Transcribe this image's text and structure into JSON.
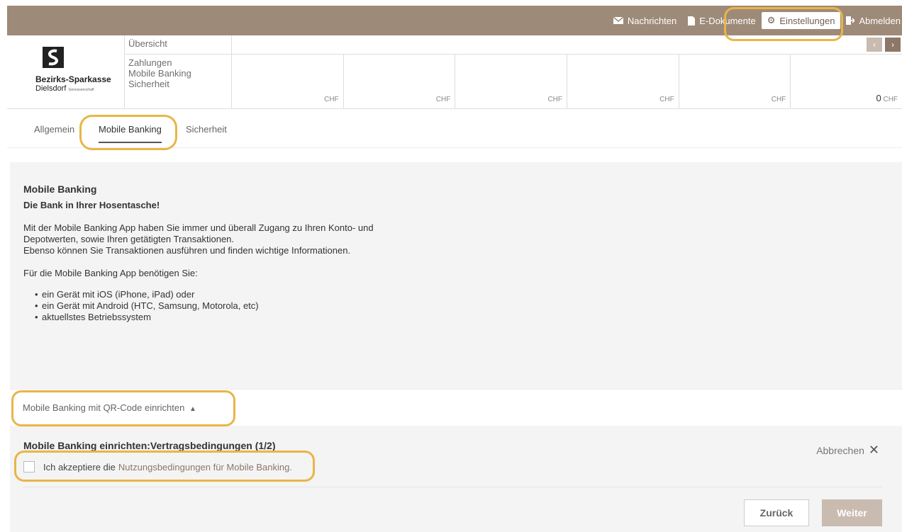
{
  "topnav": {
    "messages": "Nachrichten",
    "edocs": "E-Dokumente",
    "settings": "Einstellungen",
    "logout": "Abmelden"
  },
  "logo": {
    "line1": "Bezirks-Sparkasse",
    "line2": "Dielsdorf",
    "line2_small": "Genossenschaft"
  },
  "menu": {
    "overview": "Übersicht",
    "payments": "Zahlungen",
    "mobile": "Mobile Banking",
    "security": "Sicherheit"
  },
  "accounts": [
    {
      "amount": "",
      "currency": "CHF"
    },
    {
      "amount": "",
      "currency": "CHF"
    },
    {
      "amount": "",
      "currency": "CHF"
    },
    {
      "amount": "",
      "currency": "CHF"
    },
    {
      "amount": "",
      "currency": "CHF"
    },
    {
      "amount": "0",
      "currency": "CHF"
    }
  ],
  "tabs": {
    "general": "Allgemein",
    "mobile": "Mobile Banking",
    "security": "Sicherheit"
  },
  "content": {
    "title": "Mobile Banking",
    "subtitle": "Die Bank in Ihrer Hosentasche!",
    "para1_line1": "Mit der Mobile Banking App haben Sie immer und überall Zugang zu Ihren Konto- und",
    "para1_line2": "Depotwerten, sowie Ihren getätigten Transaktionen.",
    "para1_line3": "Ebenso können Sie Transaktionen ausführen und finden wichtige Informationen.",
    "para2": "Für die Mobile Banking App benötigen Sie:",
    "list": [
      "ein Gerät mit iOS (iPhone, iPad) oder",
      "ein Gerät mit Android (HTC, Samsung, Motorola, etc)",
      "aktuellstes Betriebssystem"
    ]
  },
  "qr": {
    "label": "Mobile Banking mit QR-Code einrichten"
  },
  "setup": {
    "title": "Mobile Banking einrichten:Vertragsbedingungen (1/2)",
    "cancel": "Abbrechen",
    "accept_text": "Ich akzeptiere die",
    "accept_link": "Nutzungsbedingungen für Mobile Banking.",
    "back": "Zurück",
    "next": "Weiter"
  },
  "colors": {
    "brand": "#9e8a78",
    "highlight": "#e9b547",
    "button_disabled": "#c9bbb0"
  }
}
